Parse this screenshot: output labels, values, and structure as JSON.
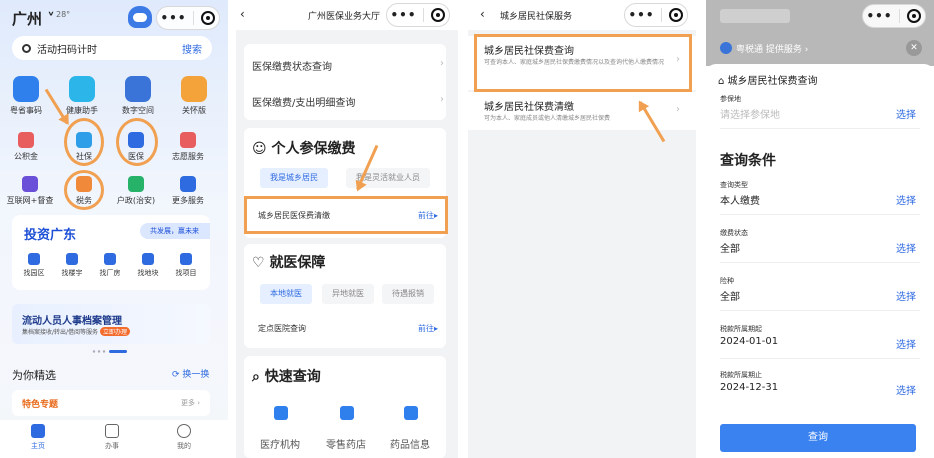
{
  "panel1": {
    "city": "广州",
    "weather": "28°",
    "search_placeholder": "活动扫码计时",
    "search_button": "搜索",
    "grid": [
      "粤省事码",
      "健康助手",
      "数字空间",
      "关怀版"
    ],
    "services": [
      "公积金",
      "社保",
      "医保",
      "志愿服务",
      "互联网+督查",
      "税务",
      "户政(治安)",
      "更多服务"
    ],
    "tz_title": "投资广东",
    "tz_badge": "共发展，赢未来",
    "tz_items": [
      "找园区",
      "找楼宇",
      "找厂房",
      "找地块",
      "找项目"
    ],
    "banner_title": "流动人员人事档案管理",
    "banner_sub": "集档案接收/转出/借阅等服务",
    "banner_btn": "立即办理",
    "picks_title": "为你精选",
    "swap": "换一换",
    "special_title": "特色专题",
    "special_more": "更多",
    "tabs": [
      "主页",
      "办事",
      "我的"
    ]
  },
  "panel2": {
    "title": "广州医保业务大厅",
    "row1": "医保缴费状态查询",
    "row2": "医保缴费/支出明细查询",
    "sec1": "个人参保缴费",
    "pill_a": "我是城乡居民",
    "pill_b": "我是灵活就业人员",
    "item1": "城乡居民医保费清缴",
    "go1": "前往",
    "sec2": "就医保障",
    "pill_c": "本地就医",
    "pill_d": "异地就医",
    "pill_e": "待遇报销",
    "item2": "定点医院查询",
    "go2": "前往",
    "sec3": "快速查询",
    "q1": "医疗机构",
    "q2": "零售药店",
    "q3": "药品信息"
  },
  "panel3": {
    "title": "城乡居民社保服务",
    "item1_title": "城乡居民社保费查询",
    "item1_desc": "可查询本人、家庭城乡居民社保费缴费情况以及查询代他人缴费情况",
    "item2_title": "城乡居民社保费清缴",
    "item2_desc": "可为本人、家庭成员或他人清缴城乡居民社保费"
  },
  "panel4": {
    "provider": "粤税通 提供服务",
    "header": "城乡居民社保费查询",
    "loc_label": "参保地",
    "loc_placeholder": "请选择参保地",
    "select": "选择",
    "cond_title": "查询条件",
    "fields": [
      {
        "label": "查询类型",
        "value": "本人缴费"
      },
      {
        "label": "缴费状态",
        "value": "全部"
      },
      {
        "label": "险种",
        "value": "全部"
      },
      {
        "label": "税款所属期起",
        "value": "2024-01-01"
      },
      {
        "label": "税款所属期止",
        "value": "2024-12-31"
      }
    ],
    "query_button": "查询"
  }
}
